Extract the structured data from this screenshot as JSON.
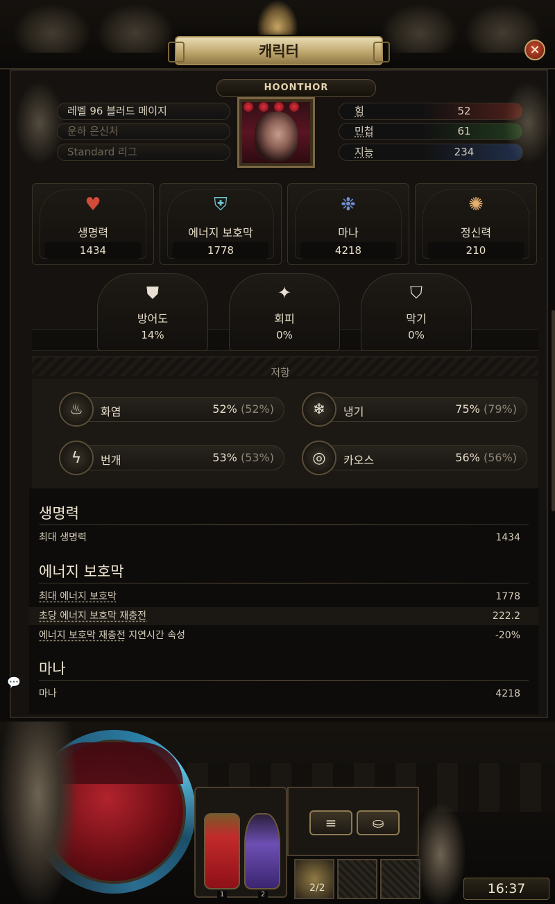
{
  "window": {
    "title": "캐릭터",
    "close_icon": "close-icon"
  },
  "character": {
    "name": "HOONTHOR",
    "level_class": "레벨 96 블러드 메이지",
    "guild": "운하 은신처",
    "league": "Standard 리그"
  },
  "attributes": [
    {
      "label": "힘",
      "value": "52",
      "color": "#c43a2e"
    },
    {
      "label": "민첩",
      "value": "61",
      "color": "#3c8a3c"
    },
    {
      "label": "지능",
      "value": "234",
      "color": "#3a6ac4"
    }
  ],
  "vitals": [
    {
      "label": "생명력",
      "value": "1434",
      "icon": "heart-icon"
    },
    {
      "label": "에너지 보호막",
      "value": "1778",
      "icon": "energy-shield-icon"
    },
    {
      "label": "마나",
      "value": "4218",
      "icon": "mana-icon"
    },
    {
      "label": "정신력",
      "value": "210",
      "icon": "spirit-icon"
    }
  ],
  "defences": [
    {
      "label": "방어도",
      "value": "14%",
      "icon": "armour-icon"
    },
    {
      "label": "회피",
      "value": "0%",
      "icon": "evasion-icon"
    },
    {
      "label": "막기",
      "value": "0%",
      "icon": "block-icon"
    }
  ],
  "resistances": {
    "title": "저항",
    "items": [
      {
        "label": "화염",
        "value": "52%",
        "max": "(52%)",
        "icon": "fire-icon"
      },
      {
        "label": "냉기",
        "value": "75%",
        "max": "(79%)",
        "icon": "cold-icon"
      },
      {
        "label": "번개",
        "value": "53%",
        "max": "(53%)",
        "icon": "lightning-icon"
      },
      {
        "label": "카오스",
        "value": "56%",
        "max": "(56%)",
        "icon": "chaos-icon"
      }
    ]
  },
  "details": {
    "life": {
      "title": "생명력",
      "rows": [
        {
          "label": "최대 생명력",
          "value": "1434"
        }
      ]
    },
    "energy_shield": {
      "title": "에너지 보호막",
      "rows": [
        {
          "label_u": "최대 에너지 보호막",
          "label_rest": "",
          "value": "1778"
        },
        {
          "label_u": "초당 에너지 보호막 재충전",
          "label_rest": "",
          "value": "222.2"
        },
        {
          "label_u": "에너지 보호막 재충전",
          "label_rest": " 지연시간 속성",
          "value": "-20%"
        }
      ]
    },
    "mana": {
      "title": "마나",
      "rows": [
        {
          "label": "마나",
          "value": "4218"
        }
      ]
    }
  },
  "hud": {
    "flask_1": "1",
    "flask_2": "2",
    "menu_icon": "≡",
    "currency_icon": "coins-icon",
    "skill_count": "2/2",
    "clock": "16:37"
  }
}
